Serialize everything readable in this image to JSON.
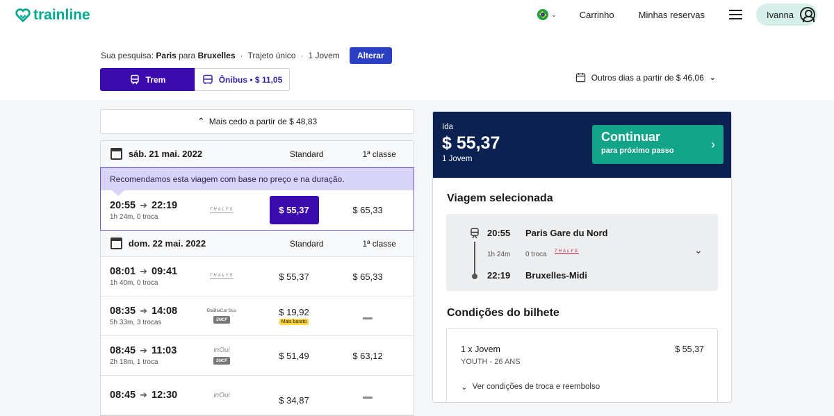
{
  "header": {
    "logo_text": "trainline",
    "cart_label": "Carrinho",
    "bookings_label": "Minhas reservas",
    "user_name": "Ivanna"
  },
  "search": {
    "prefix": "Sua pesquisa:",
    "origin": "Paris",
    "connector": "para",
    "destination": "Bruxelles",
    "trip_type": "Trajeto único",
    "passengers": "1 Jovem",
    "change_label": "Alterar"
  },
  "modes": {
    "train_label": "Trem",
    "bus_label": "Ônibus • $ 11,05"
  },
  "other_days_label": "Outros dias a partir de $ 46,06",
  "earlier_label": "Mais cedo a partir de $ 48,83",
  "days": [
    {
      "date": "sáb. 21 mai. 2022",
      "col_standard": "Standard",
      "col_first": "1ª classe",
      "recommendation": "Recomendamos esta viagem com base no preço e na duração.",
      "rows": [
        {
          "dep": "20:55",
          "arr": "22:19",
          "info": "1h 24m, 0 troca",
          "operator": "THALYS",
          "standard": "$ 55,37",
          "first": "$ 65,33"
        }
      ]
    },
    {
      "date": "dom. 22 mai. 2022",
      "col_standard": "Standard",
      "col_first": "1ª classe",
      "rows": [
        {
          "dep": "08:01",
          "arr": "09:41",
          "info": "1h 40m, 0 troca",
          "operator": "THALYS",
          "standard": "$ 55,37",
          "first": "$ 65,33"
        },
        {
          "dep": "08:35",
          "arr": "14:08",
          "info": "5h 33m, 3 trocas",
          "operator": "BlaBlaCar Bus",
          "operator2": "SNCF",
          "standard": "$ 19,92",
          "badge": "Mais barato",
          "first": ""
        },
        {
          "dep": "08:45",
          "arr": "11:03",
          "info": "2h 18m, 1 troca",
          "operator": "inOui",
          "operator2": "SNCF",
          "standard": "$ 51,49",
          "first": "$ 63,12"
        },
        {
          "dep": "08:45",
          "arr": "12:30",
          "info": "",
          "operator": "inOui",
          "standard": "$ 34,87",
          "first": ""
        }
      ]
    }
  ],
  "panel": {
    "direction": "Ida",
    "total": "$ 55,37",
    "passengers": "1 Jovem",
    "continue_title": "Continuar",
    "continue_sub": "para próximo passo",
    "selected_title": "Viagem selecionada",
    "journey": {
      "dep_time": "20:55",
      "dep_station": "Paris Gare du Nord",
      "duration": "1h 24m",
      "changes": "0 troca",
      "operator": "THALYS",
      "arr_time": "22:19",
      "arr_station": "Bruxelles-Midi"
    },
    "conditions_title": "Condições do bilhete",
    "ticket": {
      "pax": "1 x Jovem",
      "price": "$ 55,37",
      "fare": "YOUTH - 26 ANS",
      "link": "Ver condições de troca e reembolso"
    }
  },
  "colors": {
    "brand": "#00a88f",
    "primary": "#3b0bb0",
    "panel_header": "#0a2151",
    "continue": "#12a489",
    "cheapest_badge": "#ffd53d"
  }
}
